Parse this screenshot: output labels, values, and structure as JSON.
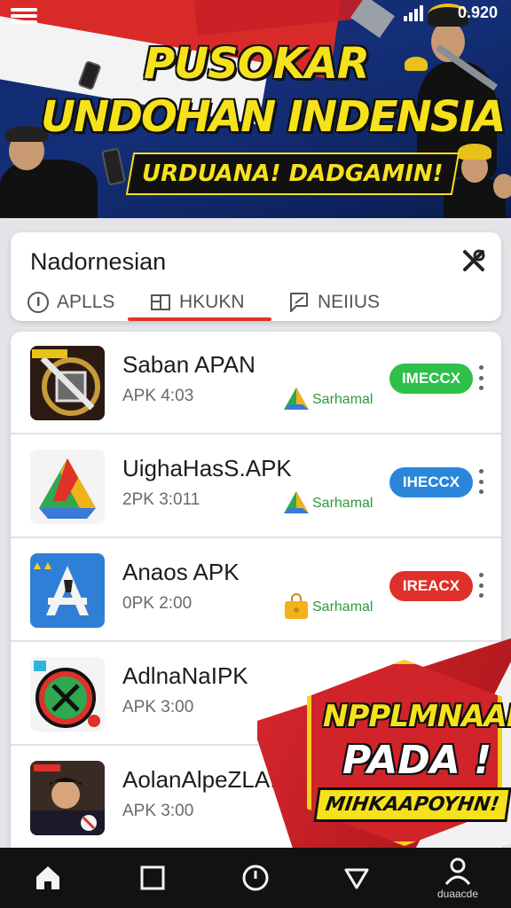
{
  "status_bar": {
    "time": "0.920"
  },
  "banner": {
    "title_line1": "PUSOKAR",
    "title_line2": "UNDOHAN INDENSIA",
    "subtitle": "URDUANA! DADGAMIN!"
  },
  "header": {
    "region_title": "Nadornesian",
    "tabs": [
      {
        "label": "APLLS",
        "icon": "info-circle-icon"
      },
      {
        "label": "HKUKN",
        "icon": "grid-icon",
        "active": true
      },
      {
        "label": "NEIIUS",
        "icon": "news-flag-icon"
      }
    ]
  },
  "apps": [
    {
      "name": "Saban APAN",
      "meta": "APK 4:03",
      "developer": "Sarhamal",
      "action": "IMECCX",
      "action_color": "#2fbf4a",
      "icon": "knife-app-icon",
      "dev_icon": "triangle-drive-icon"
    },
    {
      "name": "UighaHasS.APK",
      "meta": "2PK 3:011",
      "developer": "Sarhamal",
      "action": "IHECCX",
      "action_color": "#2a86d9",
      "icon": "drive-app-icon",
      "dev_icon": "triangle-drive-icon"
    },
    {
      "name": "Anaos APK",
      "meta": "0PK 2:00",
      "developer": "Sarhamal",
      "action": "IREACX",
      "action_color": "#e0302a",
      "icon": "appstore-app-icon",
      "dev_icon": "bag-icon"
    },
    {
      "name": "AdlnaNaIPK",
      "meta": "APK 3:00",
      "developer": "",
      "action": "",
      "action_color": "",
      "icon": "badge-app-icon",
      "dev_icon": ""
    },
    {
      "name": "AolanAlpeZLA.PK",
      "meta": "APK 3:00",
      "developer": "",
      "action": "",
      "action_color": "",
      "icon": "portrait-app-icon",
      "dev_icon": ""
    }
  ],
  "promo": {
    "line1": "NPPLMNAAN",
    "line2": "PADA !",
    "line3": "MIHKAAPOYHN!"
  },
  "bottom_nav": [
    {
      "icon": "home-icon",
      "label": ""
    },
    {
      "icon": "square-icon",
      "label": ""
    },
    {
      "icon": "clock-icon",
      "label": ""
    },
    {
      "icon": "triangle-down-icon",
      "label": ""
    },
    {
      "icon": "profile-icon",
      "label": "duaacde"
    }
  ]
}
